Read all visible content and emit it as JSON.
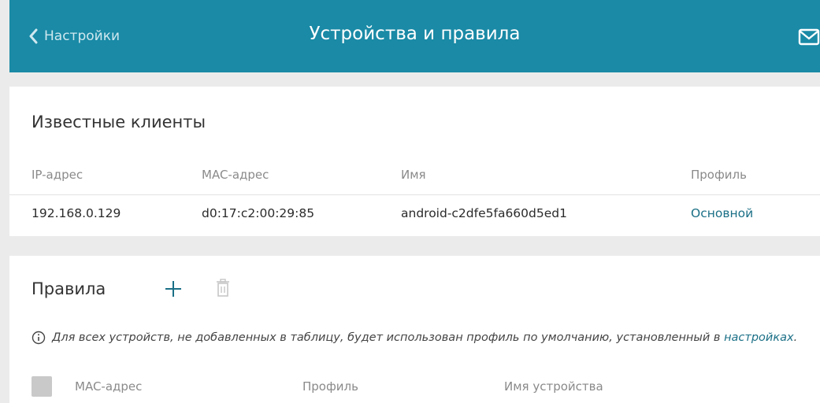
{
  "header": {
    "back_label": "Настройки",
    "title": "Устройства и правила"
  },
  "known_clients": {
    "title": "Известные клиенты",
    "columns": [
      "IP-адрес",
      "MAC-адрес",
      "Имя",
      "Профиль"
    ],
    "rows": [
      {
        "ip": "192.168.0.129",
        "mac": "d0:17:c2:00:29:85",
        "name": "android-c2dfe5fa660d5ed1",
        "profile": "Основной"
      }
    ]
  },
  "rules": {
    "title": "Правила",
    "info_text": "Для всех устройств, не добавленных в таблицу, будет использован профиль по умолчанию, установленный в ",
    "info_link": "настройках",
    "info_end": ".",
    "columns": [
      "MAC-адрес",
      "Профиль",
      "Имя устройства"
    ]
  },
  "colors": {
    "header_bg": "#1a8aa6",
    "accent": "#1a6f86"
  },
  "icons": [
    "chevron-left-icon",
    "mail-icon",
    "plus-icon",
    "trash-icon",
    "info-icon"
  ]
}
